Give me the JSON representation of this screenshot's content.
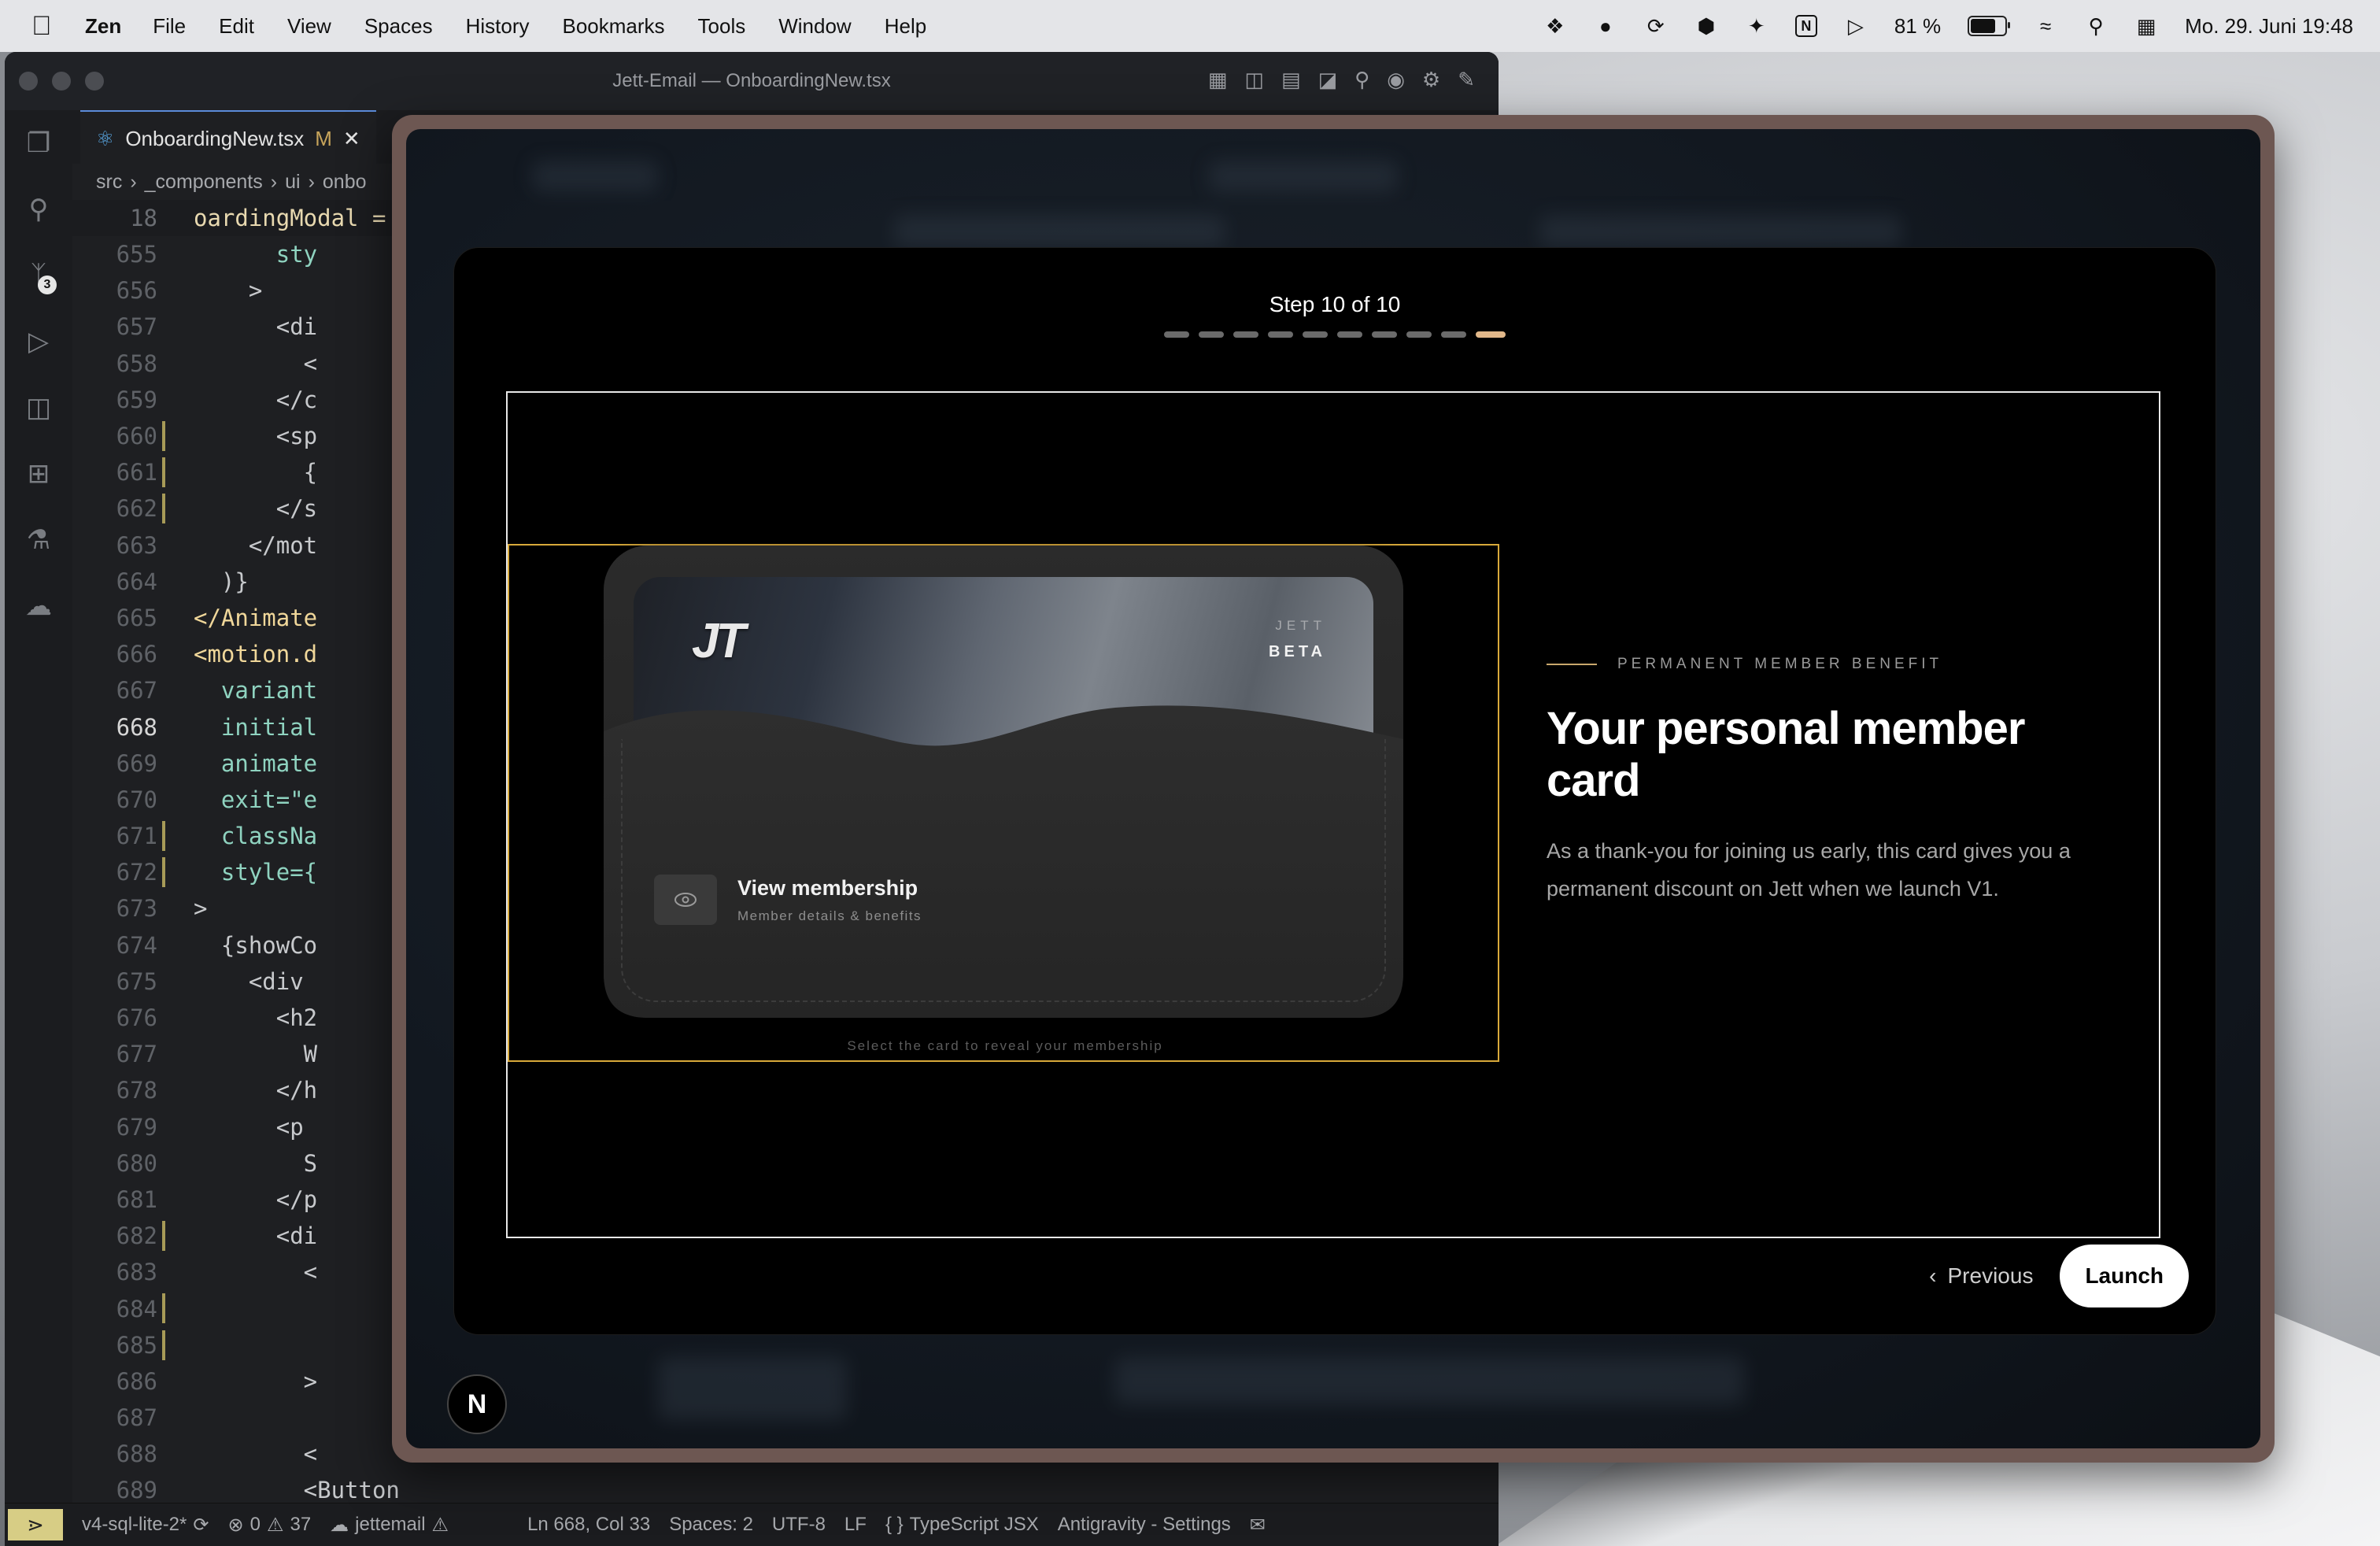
{
  "menubar": {
    "app_name": "Zen",
    "items": [
      "File",
      "Edit",
      "View",
      "Spaces",
      "History",
      "Bookmarks",
      "Tools",
      "Window",
      "Help"
    ],
    "battery_percent": "81 %",
    "battery_level": 0.81,
    "datetime": "Mo. 29. Juni 19:48"
  },
  "editor": {
    "window_title": "Jett-Email — OnboardingNew.tsx",
    "tab_label": "OnboardingNew.tsx",
    "tab_modified": "M",
    "breadcrumb": [
      "src",
      "_components",
      "ui",
      "onbo"
    ],
    "sticky_line": "18",
    "sticky_text": "oardingModal =",
    "scm_badge": "3",
    "lines": [
      {
        "n": "655",
        "t": "      sty",
        "cls": "c-attr",
        "mod": false
      },
      {
        "n": "656",
        "t": "    >",
        "cls": "c-tag",
        "mod": false
      },
      {
        "n": "657",
        "t": "      <di",
        "cls": "c-tag",
        "mod": false
      },
      {
        "n": "658",
        "t": "        <",
        "cls": "c-tag",
        "mod": false
      },
      {
        "n": "659",
        "t": "      </c",
        "cls": "c-tag",
        "mod": false
      },
      {
        "n": "660",
        "t": "      <sp",
        "cls": "c-tag",
        "mod": true
      },
      {
        "n": "661",
        "t": "        {",
        "cls": "c-tag",
        "mod": true
      },
      {
        "n": "662",
        "t": "      </s",
        "cls": "c-tag",
        "mod": true
      },
      {
        "n": "663",
        "t": "    </mot",
        "cls": "c-tag",
        "mod": false
      },
      {
        "n": "664",
        "t": "  )}",
        "cls": "c-tag",
        "mod": false
      },
      {
        "n": "665",
        "t": "</Animate",
        "cls": "c-mot",
        "mod": false
      },
      {
        "n": "666",
        "t": "<motion.d",
        "cls": "c-mot",
        "mod": false
      },
      {
        "n": "667",
        "t": "  variant",
        "cls": "c-attr",
        "mod": false
      },
      {
        "n": "668",
        "t": "  initial",
        "cls": "c-attr",
        "mod": false
      },
      {
        "n": "669",
        "t": "  animate",
        "cls": "c-attr",
        "mod": false
      },
      {
        "n": "670",
        "t": "  exit=\"e",
        "cls": "c-attr",
        "mod": false
      },
      {
        "n": "671",
        "t": "  classNa",
        "cls": "c-attr",
        "mod": true
      },
      {
        "n": "672",
        "t": "  style={",
        "cls": "c-attr",
        "mod": true
      },
      {
        "n": "673",
        "t": ">",
        "cls": "c-tag",
        "mod": false
      },
      {
        "n": "674",
        "t": "  {showCo",
        "cls": "c-tag",
        "mod": false
      },
      {
        "n": "675",
        "t": "    <div",
        "cls": "c-tag",
        "mod": false
      },
      {
        "n": "676",
        "t": "      <h2",
        "cls": "c-tag",
        "mod": false
      },
      {
        "n": "677",
        "t": "        W",
        "cls": "c-tag",
        "mod": false
      },
      {
        "n": "678",
        "t": "      </h",
        "cls": "c-tag",
        "mod": false
      },
      {
        "n": "679",
        "t": "      <p",
        "cls": "c-tag",
        "mod": false
      },
      {
        "n": "680",
        "t": "        S",
        "cls": "c-tag",
        "mod": false
      },
      {
        "n": "681",
        "t": "      </p",
        "cls": "c-tag",
        "mod": false
      },
      {
        "n": "682",
        "t": "      <di",
        "cls": "c-tag",
        "mod": true
      },
      {
        "n": "683",
        "t": "        <",
        "cls": "c-tag",
        "mod": false
      },
      {
        "n": "684",
        "t": "",
        "cls": "c-tag",
        "mod": true
      },
      {
        "n": "685",
        "t": "",
        "cls": "c-tag",
        "mod": true
      },
      {
        "n": "686",
        "t": "        >",
        "cls": "c-tag",
        "mod": false
      },
      {
        "n": "687",
        "t": "",
        "cls": "c-tag",
        "mod": false
      },
      {
        "n": "688",
        "t": "        <",
        "cls": "c-tag",
        "mod": false
      },
      {
        "n": "689",
        "t": "        <Button",
        "cls": "c-tag",
        "mod": false
      }
    ],
    "current_line": "668",
    "status": {
      "branch": "v4-sql-lite-2*",
      "errors": "0",
      "warnings": "37",
      "remote": "jettemail",
      "position": "Ln 668, Col 33",
      "spaces": "Spaces: 2",
      "encoding": "UTF-8",
      "eol": "LF",
      "language": "TypeScript JSX",
      "extension": "Antigravity - Settings"
    }
  },
  "peek": {
    "label1": "mail",
    "label2": "n",
    "label3": "ta"
  },
  "modal": {
    "step_label": "Step 10 of 10",
    "total_steps": 10,
    "current_step": 10,
    "card": {
      "logo": "JT",
      "brand": "JETT",
      "tier": "BETA"
    },
    "view_button": {
      "title": "View membership",
      "subtitle": "Member details & benefits"
    },
    "hint": "Select the card to reveal your membership",
    "eyebrow": "PERMANENT MEMBER BENEFIT",
    "headline": "Your personal member card",
    "body": "As a thank-you for joining us early, this card gives you a permanent discount on Jett when we launch V1.",
    "previous_label": "Previous",
    "launch_label": "Launch"
  },
  "corner_badge": "N",
  "colors": {
    "accent_progress": "#e2b88a",
    "highlight_border": "#d8a93a",
    "eyebrow_rule": "#c9a86d"
  }
}
